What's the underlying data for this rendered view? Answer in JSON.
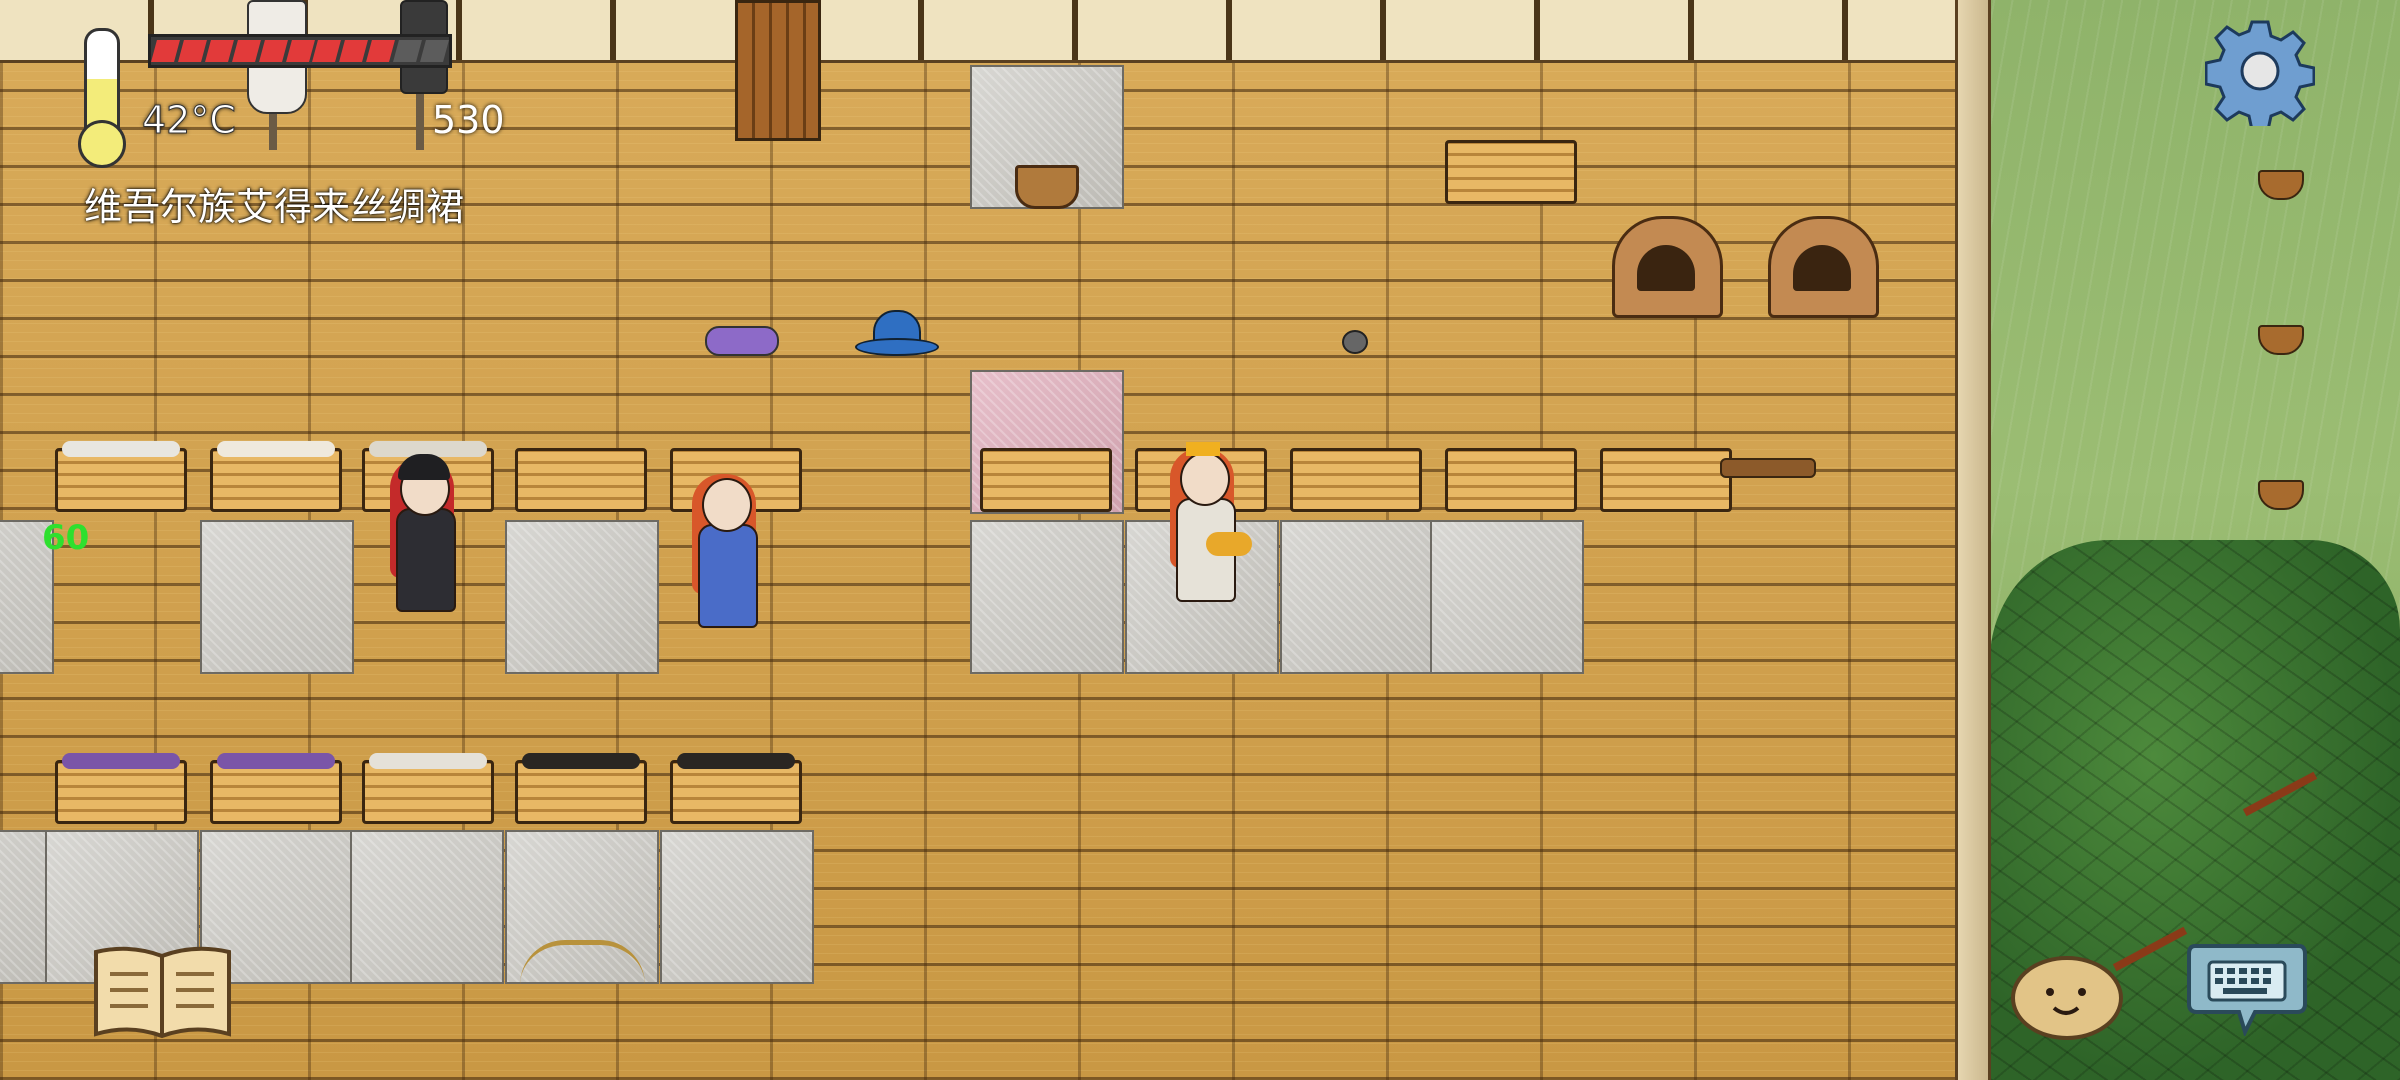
{
  "hud": {
    "temperature": "42°C",
    "score": "530",
    "selected_item": "维吾尔族艾得来丝绸裙",
    "fps": "60",
    "food_pips_total": 11,
    "food_pips_filled": 9
  },
  "controls": {
    "settings_icon": "gear-icon",
    "book_icon": "book-icon",
    "emote_icon": "emote-face-icon",
    "keyboard_icon": "keyboard-icon"
  },
  "colors": {
    "food_bar": "#e23a3a",
    "fps_text": "#2ee02e",
    "settings_gear": "#6f9ed0",
    "keyboard_bubble": "#8fb9c9"
  }
}
